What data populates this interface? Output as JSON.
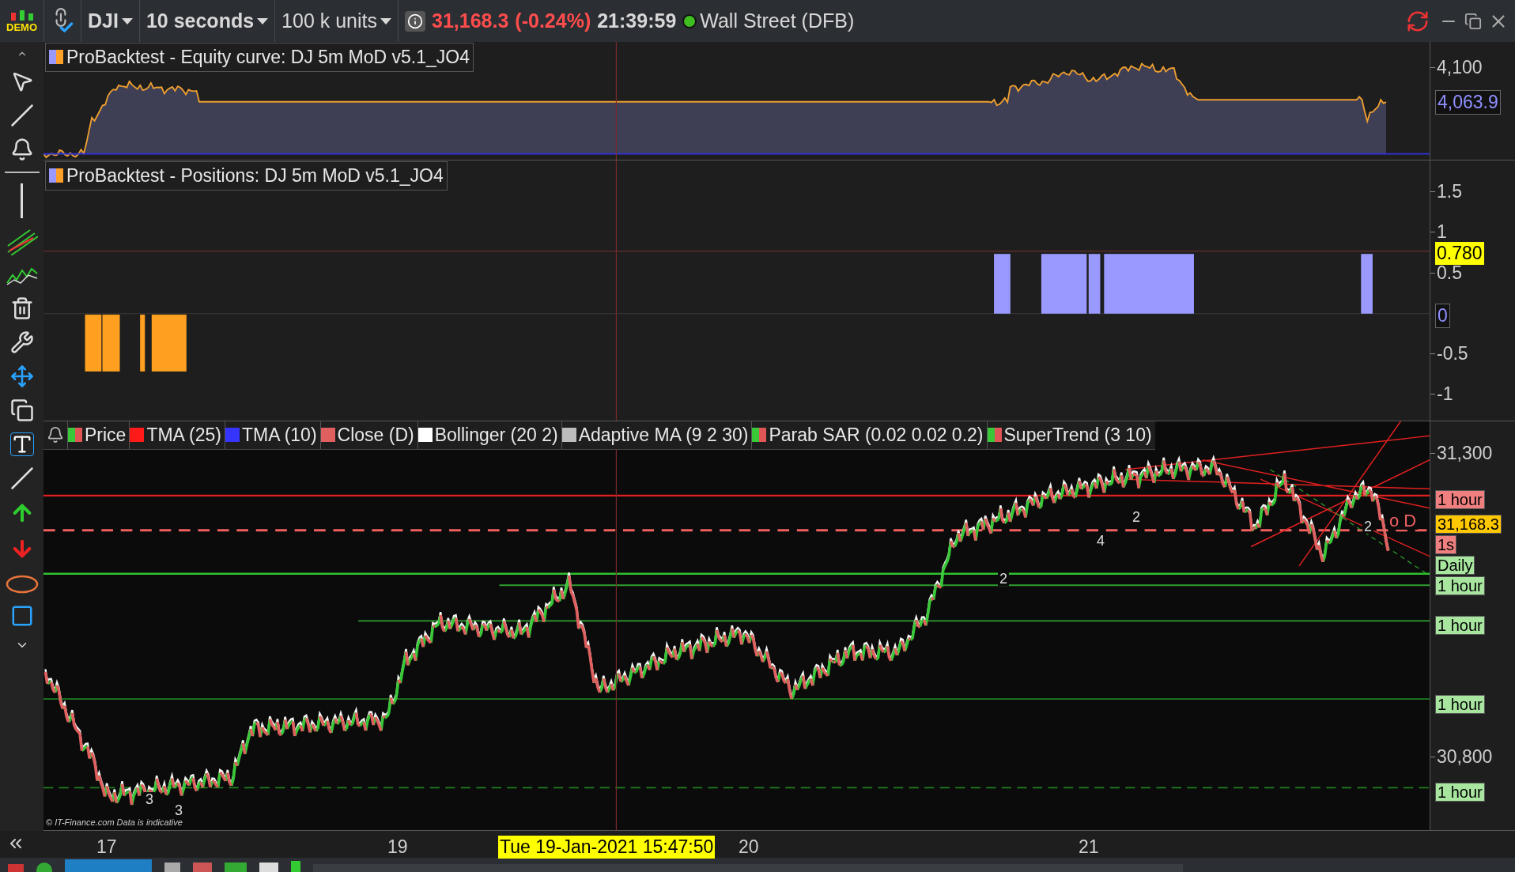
{
  "top_bar": {
    "logo_text": "DEMO",
    "symbol": "DJI",
    "timeframe": "10 seconds",
    "units": "100 k units",
    "price": "31,168.3",
    "change": "(-0.24%)",
    "time": "21:39:59",
    "market": "Wall Street (DFB)"
  },
  "equity_panel": {
    "title": "ProBacktest - Equity curve: DJ 5m MoD v5.1_JO4",
    "axis_ticks": [
      "4,100"
    ],
    "value_tag": "4,063.9"
  },
  "positions_panel": {
    "title": "ProBacktest - Positions: DJ 5m MoD v5.1_JO4",
    "axis_ticks": [
      "1.5",
      "1",
      "0.5",
      "-0.5",
      "-1"
    ],
    "value_tag": "0.780",
    "zero_tag": "0"
  },
  "price_panel": {
    "legend": [
      {
        "label": "Price",
        "kind": "split",
        "color": "#e05555"
      },
      {
        "label": "TMA (25)",
        "kind": "solid",
        "color": "#ff1a1a"
      },
      {
        "label": "TMA (10)",
        "kind": "solid",
        "color": "#3535ff"
      },
      {
        "label": "Close (D)",
        "kind": "solid",
        "color": "#e06060"
      },
      {
        "label": "Bollinger (20 2)",
        "kind": "solid",
        "color": "#ffffff"
      },
      {
        "label": "Adaptive MA (9 2 30)",
        "kind": "solid",
        "color": "#bdbdbd"
      },
      {
        "label": "Parab SAR (0.02 0.02 0.2)",
        "kind": "split",
        "color": "#e05555"
      },
      {
        "label": "SuperTrend (3 10)",
        "kind": "split",
        "color": "#e05555"
      }
    ],
    "annotations": [
      "3",
      "3",
      "2",
      "4",
      "2",
      "2",
      "o D"
    ],
    "credit": "© IT-Finance.com Data is indicative",
    "axis_ticks": [
      "31,300",
      "30,800"
    ],
    "axis_tags": [
      {
        "text": "1 hour",
        "kind": "red"
      },
      {
        "text": "31,168.3",
        "kind": "yellow"
      },
      {
        "text": "1s",
        "kind": "red"
      },
      {
        "text": "Daily",
        "kind": "green"
      },
      {
        "text": "1 hour",
        "kind": "green"
      },
      {
        "text": "1 hour",
        "kind": "green"
      },
      {
        "text": "1 hour",
        "kind": "green"
      },
      {
        "text": "1 hour",
        "kind": "green"
      }
    ]
  },
  "x_axis": {
    "labels": [
      "17",
      "19",
      "20",
      "21"
    ],
    "cursor_tag": "Tue 19-Jan-2021 15:47:50"
  }
}
